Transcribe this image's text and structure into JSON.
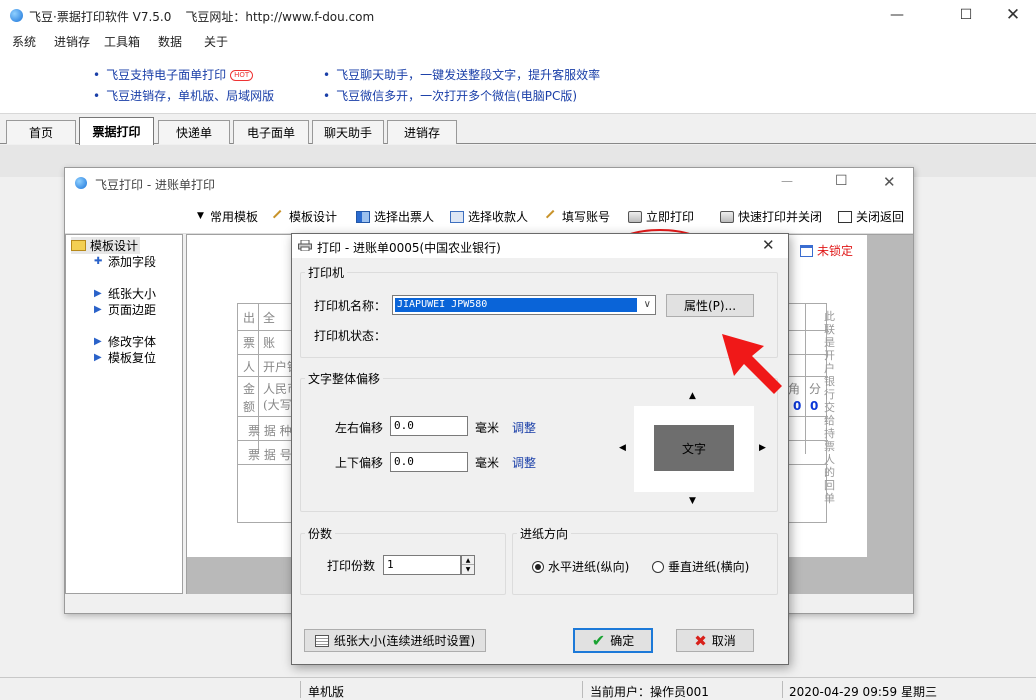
{
  "main_window": {
    "title": "飞豆·票据打印软件 V7.5.0",
    "url_label": "飞豆网址：http://www.f-dou.com"
  },
  "menu": [
    "系统",
    "进销存",
    "工具箱",
    "数据",
    "关于"
  ],
  "notices": [
    {
      "text": "飞豆支持电子面单打印",
      "badge": "HOT"
    },
    {
      "text": "飞豆进销存，单机版、局域网版"
    },
    {
      "text": "飞豆聊天助手，一键发送整段文字，提升客服效率"
    },
    {
      "text": "飞豆微信多开，一次打开多个微信(电脑PC版)"
    }
  ],
  "tabs": [
    "首页",
    "票据打印",
    "快递单",
    "电子面单",
    "聊天助手",
    "进销存"
  ],
  "active_tab": "票据打印",
  "child_window": {
    "title": "飞豆打印 - 进账单打印",
    "toolbar": [
      "常用模板",
      "模板设计",
      "选择出票人",
      "选择收款人",
      "填写账号",
      "立即打印",
      "快速打印并关闭",
      "关闭返回"
    ],
    "tree": {
      "root": "模板设计",
      "items": [
        "添加字段",
        "纸张大小",
        "页面边距",
        "修改字体",
        "模板复位"
      ]
    },
    "locked_label": "未锁定",
    "side_note": "此联是开户银行交给持票人的回单",
    "form_cells": [
      "出",
      "全",
      "票",
      "账",
      "人",
      "开户银",
      "金",
      "额",
      "人民币",
      "(大写)",
      "票 据 种",
      "票 据 号",
      "角",
      "分"
    ],
    "amount_zeros": [
      "0",
      "0"
    ]
  },
  "dialog": {
    "title": "打印 - 进账单0005(中国农业银行)",
    "printer_group": "打印机",
    "printer_name_label": "打印机名称：",
    "printer_name_value": "JIAPUWEI JPW580",
    "properties_button": "属性(P)...",
    "printer_status_label": "打印机状态：",
    "offset_group": "文字整体偏移",
    "lr_offset_label": "左右偏移",
    "lr_offset_value": "0.0",
    "ud_offset_label": "上下偏移",
    "ud_offset_value": "0.0",
    "unit": "毫米",
    "adjust_link": "调整",
    "preview_text": "文字",
    "copies_group": "份数",
    "copies_label": "打印份数",
    "copies_value": "1",
    "feed_group": "进纸方向",
    "feed_options": [
      "水平进纸(纵向)",
      "垂直进纸(横向)"
    ],
    "feed_selected": 0,
    "paper_size_button": "纸张大小(连续进纸时设置)",
    "ok_button": "确定",
    "cancel_button": "取消"
  },
  "statusbar": {
    "edition": "单机版",
    "user": "当前用户：操作员001",
    "datetime": "2020-04-29  09:59  星期三"
  },
  "colors": {
    "link_blue": "#1a3fa8",
    "highlight_red": "#e41a1a",
    "selection_blue": "#0a64d8"
  }
}
